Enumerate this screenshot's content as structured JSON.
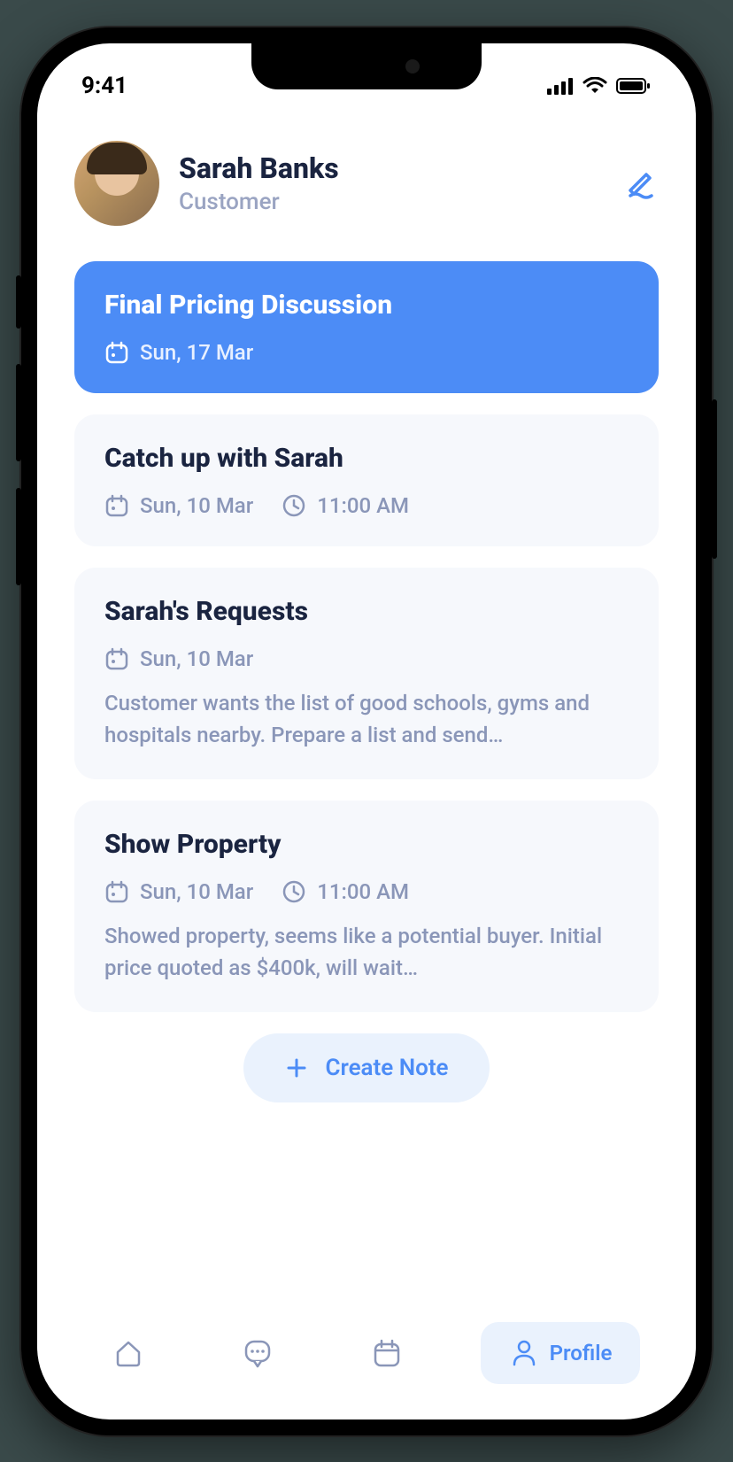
{
  "status": {
    "time": "9:41"
  },
  "profile": {
    "name": "Sarah Banks",
    "role": "Customer"
  },
  "cards": [
    {
      "title": "Final Pricing Discussion",
      "date": "Sun, 17 Mar",
      "time": null,
      "body": null,
      "primary": true
    },
    {
      "title": "Catch up with Sarah",
      "date": "Sun, 10 Mar",
      "time": "11:00 AM",
      "body": null,
      "primary": false
    },
    {
      "title": "Sarah's Requests",
      "date": "Sun, 10 Mar",
      "time": null,
      "body": "Customer wants the list of good schools, gyms and hospitals nearby. Prepare a list and send…",
      "primary": false
    },
    {
      "title": "Show Property",
      "date": "Sun, 10 Mar",
      "time": "11:00 AM",
      "body": "Showed property, seems like a potential buyer. Initial price quoted as $400k, will wait…",
      "primary": false
    }
  ],
  "actions": {
    "create_note": "Create Note"
  },
  "nav": {
    "profile_label": "Profile"
  }
}
